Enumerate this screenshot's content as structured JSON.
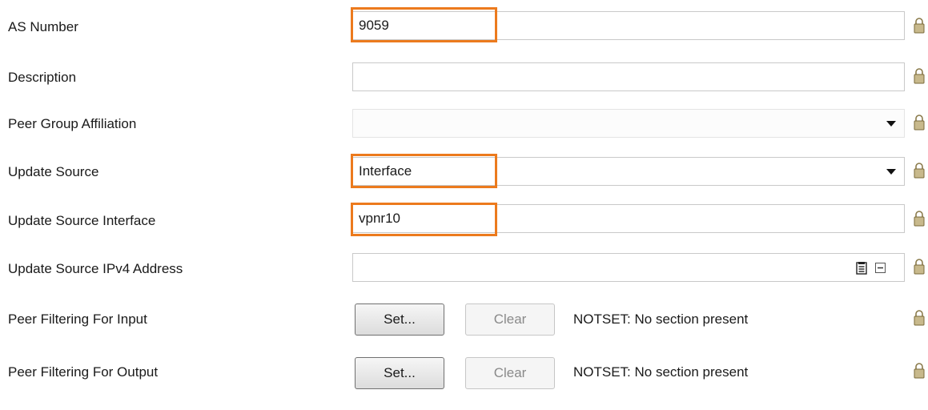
{
  "rows": [
    {
      "label": "AS Number",
      "value": "9059"
    },
    {
      "label": "Description",
      "value": ""
    },
    {
      "label": "Peer Group Affiliation",
      "value": ""
    },
    {
      "label": "Update Source",
      "value": "Interface"
    },
    {
      "label": "Update Source Interface",
      "value": "vpnr10"
    },
    {
      "label": "Update Source IPv4 Address",
      "value": ""
    },
    {
      "label": "Peer Filtering For Input",
      "set_label": "Set...",
      "clear_label": "Clear",
      "status": "NOTSET: No section present"
    },
    {
      "label": "Peer Filtering For Output",
      "set_label": "Set...",
      "clear_label": "Clear",
      "status": "NOTSET: No section present"
    }
  ],
  "colors": {
    "highlight": "#ec7a1d",
    "lock": "#c8b98c"
  },
  "icons": [
    "lock-icon",
    "dropdown-arrow-icon",
    "notes-icon",
    "minus-icon"
  ]
}
